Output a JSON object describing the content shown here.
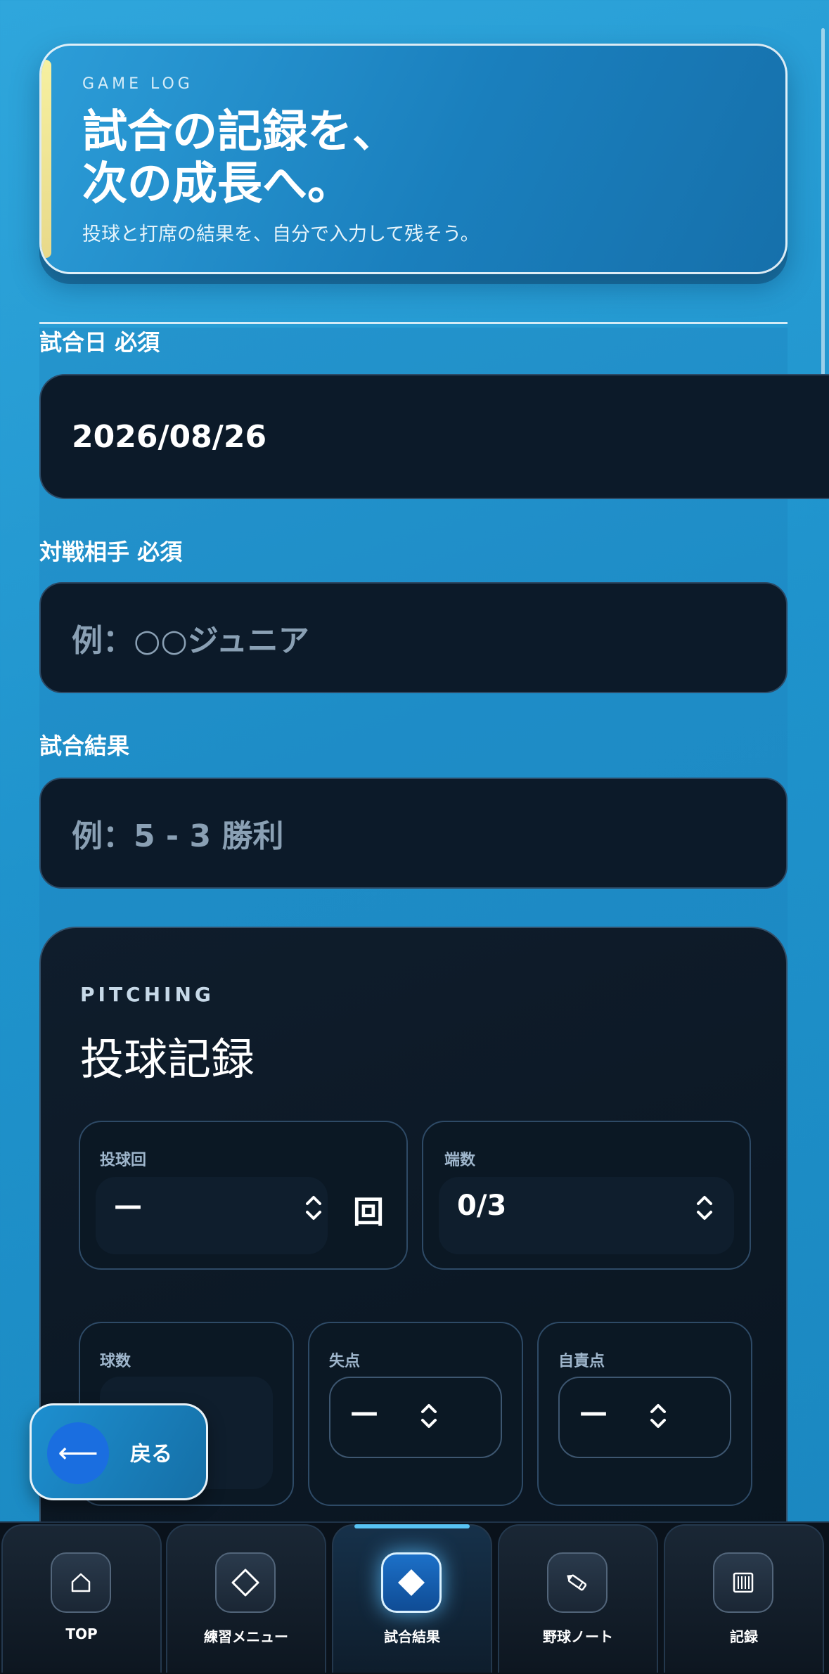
{
  "hero": {
    "eyebrow": "GAME LOG",
    "title_line1": "試合の記録を、",
    "title_line2": "次の成長へ。",
    "subtitle": "投球と打席の結果を、自分で入力して残そう。"
  },
  "form": {
    "date_label": "試合日 必須",
    "date_value": "2026/08/26",
    "opponent_label": "対戦相手 必須",
    "opponent_placeholder": "例：○○ジュニア",
    "result_label": "試合結果",
    "result_placeholder": "例：5 - 3 勝利"
  },
  "pitching": {
    "eyebrow": "PITCHING",
    "title": "投球記録",
    "innings_label": "投球回",
    "innings_value": "—",
    "innings_unit": "回",
    "outs_label": "端数",
    "outs_value": "0/3",
    "pitches_label": "球数",
    "runs_label": "失点",
    "runs_value": "—",
    "earned_label": "自責点",
    "earned_value": "—"
  },
  "back_button": {
    "arrow": "⟵",
    "label": "戻る"
  },
  "nav": {
    "items": [
      {
        "label": "TOP",
        "icon": "home-icon",
        "active": false
      },
      {
        "label": "練習メニュー",
        "icon": "diamond-outline-icon",
        "active": false
      },
      {
        "label": "試合結果",
        "icon": "diamond-filled-icon",
        "active": true
      },
      {
        "label": "野球ノート",
        "icon": "pencil-icon",
        "active": false
      },
      {
        "label": "記録",
        "icon": "records-icon",
        "active": false
      }
    ]
  }
}
